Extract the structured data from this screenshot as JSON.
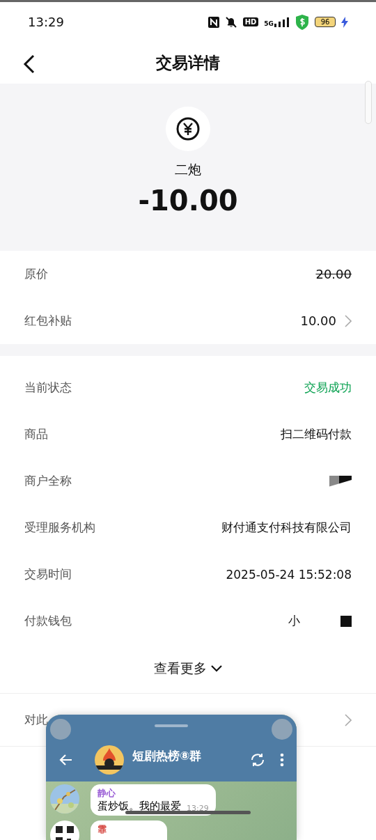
{
  "status_bar": {
    "time": "13:29",
    "hd_label": "HD",
    "network": "5G",
    "battery": "96",
    "charging": true
  },
  "header": {
    "title": "交易详情"
  },
  "summary": {
    "merchant": "二炮",
    "amount": "-10.00"
  },
  "price_rows": [
    {
      "label": "原价",
      "value": "20.00",
      "struck": true,
      "has_arrow": false
    },
    {
      "label": "红包补贴",
      "value": "10.00",
      "struck": false,
      "has_arrow": true
    }
  ],
  "detail_rows": [
    {
      "label": "当前状态",
      "value": "交易成功",
      "kind": "status",
      "color": "#07a04f"
    },
    {
      "label": "商品",
      "value": "扫二维码付款",
      "kind": "text"
    },
    {
      "label": "商户全称",
      "kind": "masked"
    },
    {
      "label": "受理服务机构",
      "value": "财付通支付科技有限公司",
      "kind": "text"
    },
    {
      "label": "交易时间",
      "value": "2025-05-24 15:52:08",
      "kind": "text"
    },
    {
      "label": "付款钱包",
      "value": "小",
      "kind": "partly_masked"
    }
  ],
  "more_button": {
    "label": "查看更多"
  },
  "bottom_row": {
    "label": "对此",
    "has_arrow": true
  },
  "floating_chat": {
    "title": "短剧热榜⑧群",
    "messages": [
      {
        "sender": "静心",
        "color": "#9b5fd6",
        "text": "蛋炒饭。我的最爱",
        "time": "13:29"
      },
      {
        "sender": "霏",
        "color": "#d4403a"
      }
    ]
  }
}
